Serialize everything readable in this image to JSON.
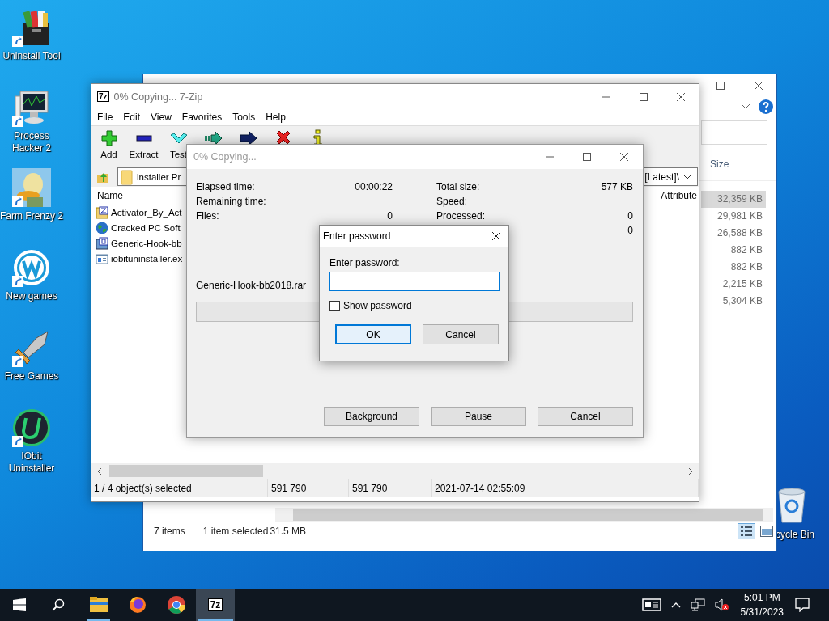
{
  "desktop_icons": [
    {
      "label": "Uninstall Tool",
      "kind": "uninstall"
    },
    {
      "label": "Process Hacker 2",
      "kind": "monitor"
    },
    {
      "label": "Farm Frenzy 2",
      "kind": "bird"
    },
    {
      "label": "New games",
      "kind": "ring"
    },
    {
      "label": "Free Games",
      "kind": "sword"
    },
    {
      "label": "IObit Uninstaller",
      "kind": "disc"
    }
  ],
  "recycle_bin": {
    "label": "cycle Bin"
  },
  "explorer_window": {
    "column_header": "Size",
    "sizes": [
      {
        "text": "32,359 KB",
        "selected": true
      },
      {
        "text": "29,981 KB",
        "selected": false
      },
      {
        "text": "26,588 KB",
        "selected": false
      },
      {
        "text": "882 KB",
        "selected": false
      },
      {
        "text": "882 KB",
        "selected": false
      },
      {
        "text": "2,215 KB",
        "selected": false
      },
      {
        "text": "5,304 KB",
        "selected": false
      }
    ],
    "status": {
      "item_count": "7 items",
      "selection": "1 item selected",
      "selection_size": "31.5 MB"
    }
  },
  "zip_window": {
    "logo_text": "7z",
    "title": "0% Copying... 7-Zip",
    "menu": [
      "File",
      "Edit",
      "View",
      "Favorites",
      "Tools",
      "Help"
    ],
    "toolbar": [
      {
        "label": "Add",
        "kind": "add"
      },
      {
        "label": "Extract",
        "kind": "extract"
      },
      {
        "label": "Test",
        "kind": "test"
      },
      {
        "kind": "copy"
      },
      {
        "kind": "move"
      },
      {
        "kind": "delete"
      },
      {
        "kind": "info"
      }
    ],
    "path": "installer Pr",
    "path_tail": "[Latest]\\",
    "columns": [
      "Name",
      "Attribute"
    ],
    "files": [
      {
        "name": "Activator_By_Act",
        "kind": "archive"
      },
      {
        "name": "Cracked PC Soft",
        "kind": "globe"
      },
      {
        "name": "Generic-Hook-bb",
        "kind": "rar"
      },
      {
        "name": "iobituninstaller.ex",
        "kind": "exe"
      }
    ],
    "status": [
      "1 / 4 object(s) selected",
      "591 790",
      "591 790",
      "2021-07-14 02:55:09"
    ]
  },
  "progress_dialog": {
    "title": "0% Copying...",
    "left_stats": [
      {
        "label": "Elapsed time:",
        "value": "00:00:22"
      },
      {
        "label": "Remaining time:"
      },
      {
        "label": "Files:",
        "value": "0"
      }
    ],
    "right_stats": [
      {
        "label": "Total size:",
        "value": "577 KB"
      },
      {
        "label": "Speed:"
      },
      {
        "label": "Processed:",
        "value": "0"
      },
      {
        "value": "0"
      }
    ],
    "current_file": "Generic-Hook-bb2018.rar",
    "progress": {
      "level": 0
    },
    "buttons": [
      "Background",
      "Pause",
      "Cancel"
    ]
  },
  "password_dialog": {
    "title": "Enter password",
    "field_label": "Enter password:",
    "show_password": {
      "label": "Show password",
      "checked": false
    },
    "buttons": [
      {
        "label": "OK",
        "default": true
      },
      {
        "label": "Cancel",
        "default": false
      }
    ]
  },
  "taskbar": {
    "apps": [
      {
        "kind": "folder",
        "running": true,
        "active": false
      },
      {
        "kind": "firefox",
        "running": false,
        "active": false
      },
      {
        "kind": "chrome",
        "running": false,
        "active": false
      },
      {
        "kind": "sevenzip",
        "logo_text": "7z",
        "running": true,
        "active": true
      }
    ],
    "clock": {
      "time": "5:01 PM",
      "date": "5/31/2023"
    }
  }
}
